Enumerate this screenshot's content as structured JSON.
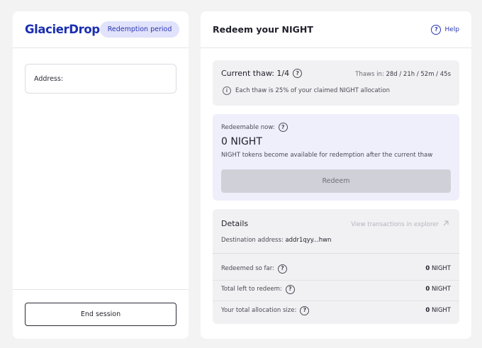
{
  "left": {
    "logo": "GlacierDrop",
    "badge": "Redemption period",
    "address_label": "Address:",
    "end_session": "End session"
  },
  "right": {
    "title": "Redeem your NIGHT",
    "help": "Help"
  },
  "thaw": {
    "label": "Current thaw: 1/4",
    "time_prefix": "Thaws in:",
    "time_value": "28d / 21h / 52m / 45s",
    "note": "Each thaw is 25% of your claimed NIGHT allocation"
  },
  "redeem": {
    "label": "Redeemable now:",
    "amount": "0 NIGHT",
    "note": "NIGHT tokens become available for redemption after the current thaw",
    "button": "Redeem"
  },
  "details": {
    "title": "Details",
    "explorer_link": "View transactions in explorer",
    "destination_label": "Destination address:",
    "destination_value": "addr1qyy...hwn",
    "rows": [
      {
        "label": "Redeemed so far:",
        "amount": "0",
        "unit": "NIGHT"
      },
      {
        "label": "Total left to redeem:",
        "amount": "0",
        "unit": "NIGHT"
      },
      {
        "label": "Your total allocation size:",
        "amount": "0",
        "unit": "NIGHT"
      }
    ]
  },
  "colors": {
    "brand": "#1b2fb0",
    "badge_bg": "#e1e2fb",
    "redeem_card_bg": "#efeffb",
    "disabled_button": "#d0d0d8"
  },
  "icons": {
    "help": "question-circle-icon",
    "info": "info-circle-icon",
    "external": "arrow-up-right-icon"
  }
}
